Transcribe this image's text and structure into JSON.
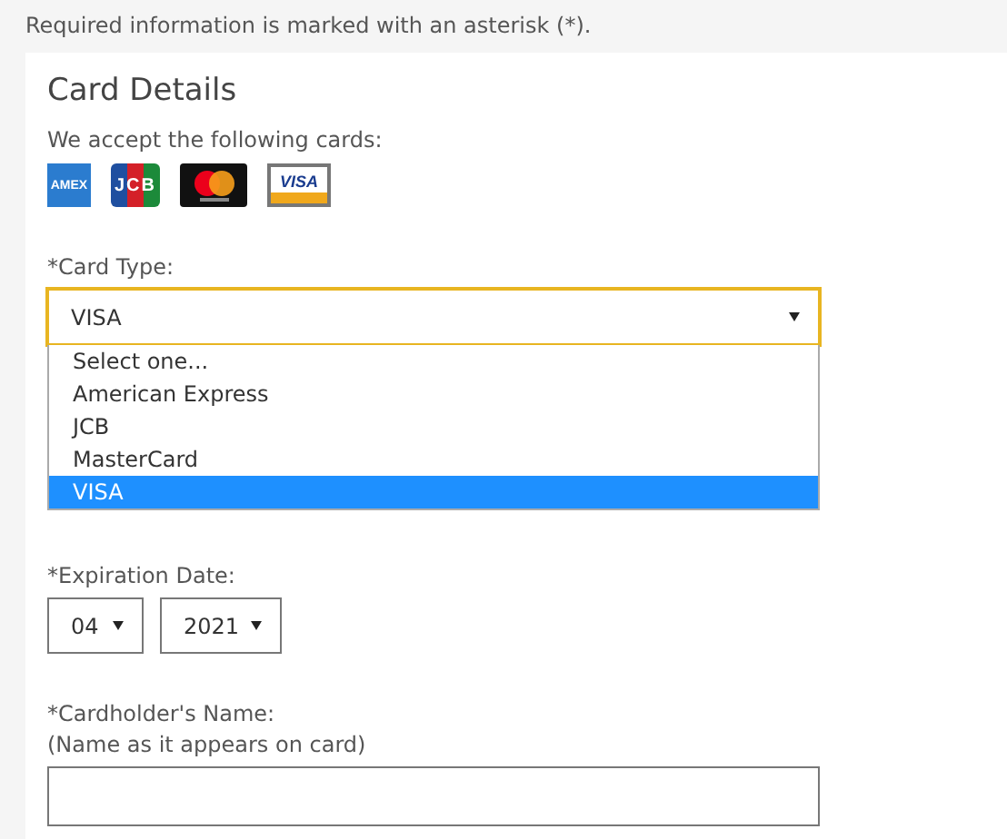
{
  "notice": "Required information is marked with an asterisk (*).",
  "card": {
    "title": "Card Details",
    "accept_label": "We accept the following cards:",
    "logos": [
      {
        "kind": "amex",
        "label": "AMEX"
      },
      {
        "kind": "jcb",
        "label": "JCB"
      },
      {
        "kind": "mastercard"
      },
      {
        "kind": "visa",
        "label": "VISA"
      }
    ]
  },
  "card_type": {
    "label": "*Card Type:",
    "value": "VISA",
    "expanded": true,
    "options": [
      {
        "label": "Select one...",
        "selected": false
      },
      {
        "label": "American Express",
        "selected": false
      },
      {
        "label": "JCB",
        "selected": false
      },
      {
        "label": "MasterCard",
        "selected": false
      },
      {
        "label": "VISA",
        "selected": true
      }
    ]
  },
  "expiration": {
    "label": "*Expiration Date:",
    "month": "04",
    "year": "2021"
  },
  "cardholder": {
    "label": "*Cardholder's Name:",
    "hint": "(Name as it appears on card)"
  }
}
